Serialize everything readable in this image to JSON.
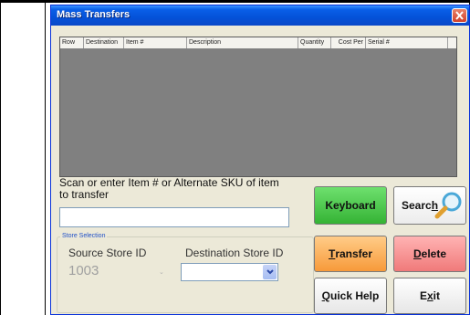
{
  "window": {
    "title": "Mass Transfers"
  },
  "grid": {
    "columns": [
      "Row",
      "Destination",
      "Item #",
      "Description",
      "Quantity",
      "Cost Per",
      "Serial #"
    ],
    "rows": []
  },
  "scan": {
    "label": "Scan or enter Item # or Alternate SKU of item to transfer",
    "value": ""
  },
  "store_selection": {
    "legend": "Store Selection",
    "source_label": "Source Store ID",
    "source_value": "1003",
    "destination_label": "Destination Store ID",
    "destination_value": ""
  },
  "buttons": {
    "keyboard": "Keyboard",
    "search_pre": "Searc",
    "search_u": "h",
    "transfer_u": "T",
    "transfer_rest": "ransfer",
    "delete_u": "D",
    "delete_rest": "elete",
    "quickhelp_u": "Q",
    "quickhelp_rest": "uick Help",
    "exit_pre": "E",
    "exit_u": "x",
    "exit_post": "it"
  },
  "colors": {
    "keyboard": "#35b335",
    "transfer": "#f79a3a",
    "delete": "#f07a7a",
    "titlebar": "#0452d8"
  },
  "icons": {
    "close": "close-icon",
    "search": "magnifier-icon",
    "dropdown": "chevron-down-icon"
  }
}
